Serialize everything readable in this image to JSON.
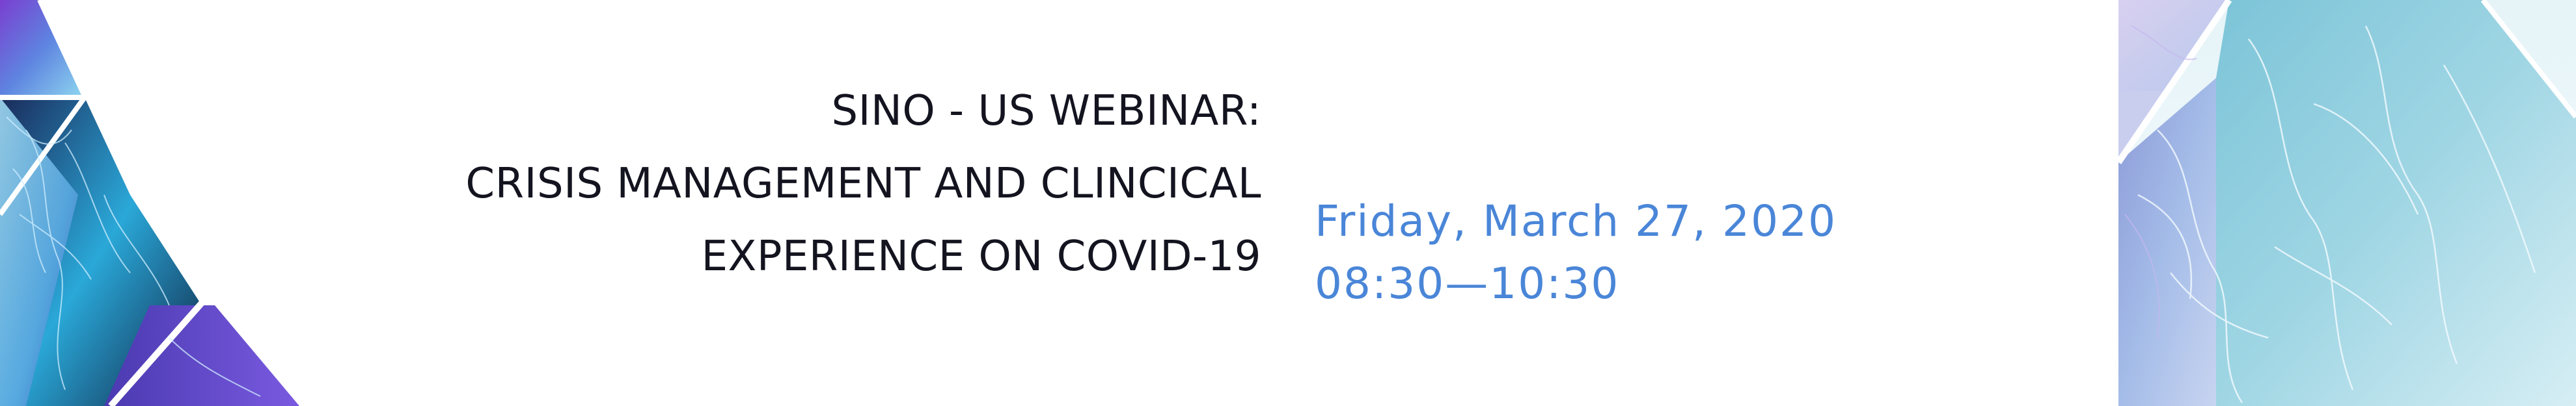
{
  "event": {
    "title_lines": [
      "SINO - US WEBINAR:",
      "CRISIS MANAGEMENT AND CLINCICAL",
      "EXPERIENCE ON COVID-19"
    ],
    "date": "Friday, March 27, 2020",
    "time": "08:30—10:30"
  },
  "colors": {
    "title_text": "#141420",
    "date_text": "#4a86d8",
    "accent_purple": "#6a3cc8",
    "accent_cyan": "#5ac8e0"
  },
  "decorations": {
    "left": "lung-xray-artwork",
    "right": "lung-xray-artwork"
  }
}
